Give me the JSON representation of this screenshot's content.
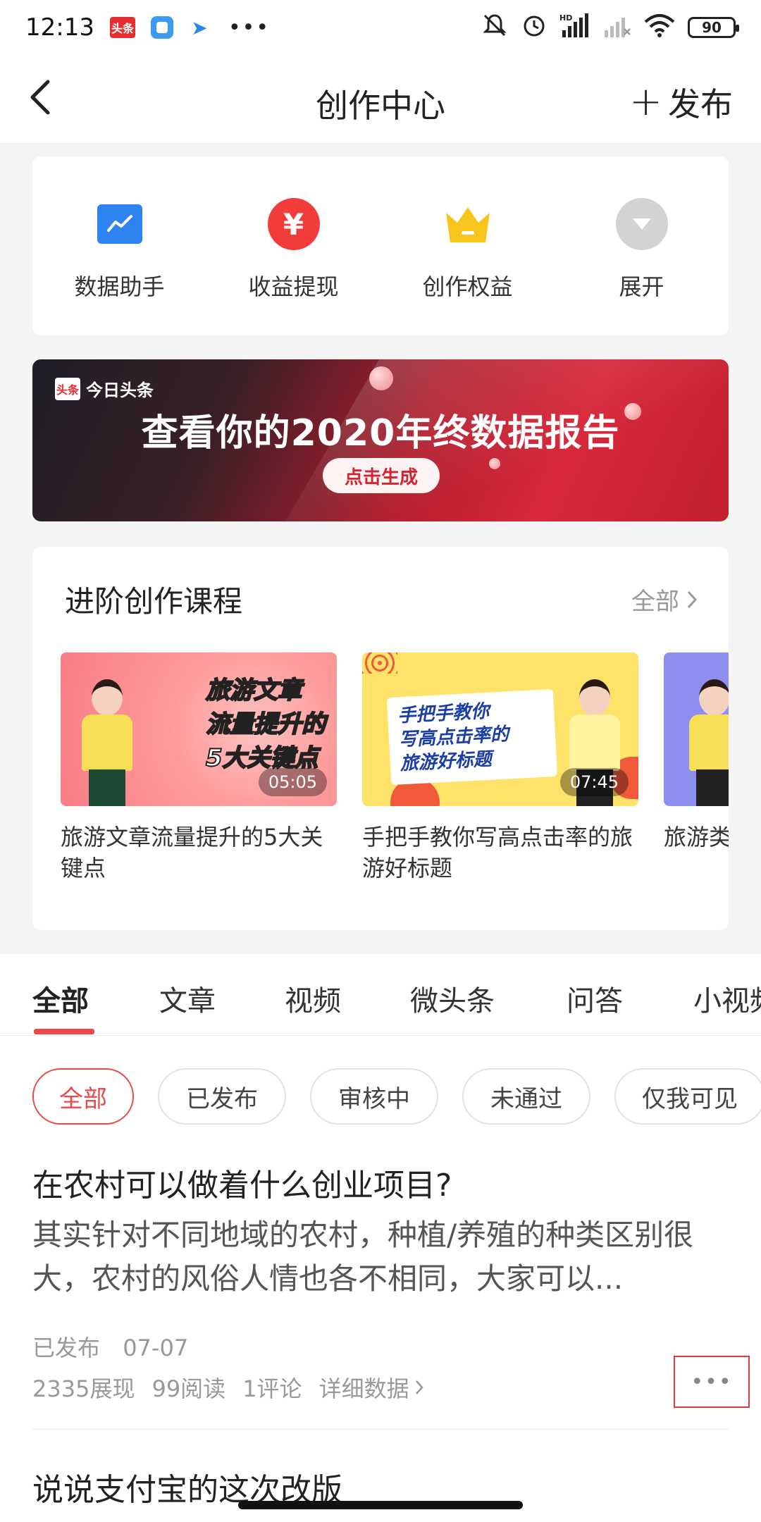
{
  "status_bar": {
    "time": "12:13",
    "toutiao_badge": "头条",
    "battery": "90",
    "network": "HD"
  },
  "nav": {
    "title": "创作中心",
    "publish_label": "发布"
  },
  "tools": [
    {
      "label": "数据助手",
      "icon": "data-chart-icon"
    },
    {
      "label": "收益提现",
      "icon": "yuan-money-icon"
    },
    {
      "label": "创作权益",
      "icon": "crown-icon"
    },
    {
      "label": "展开",
      "icon": "expand-arrow-icon"
    }
  ],
  "banner": {
    "brand": "今日头条",
    "brand_mark": "头条",
    "title": "查看你的2020年终数据报告",
    "button": "点击生成"
  },
  "courses": {
    "heading": "进阶创作课程",
    "view_all": "全部",
    "items": [
      {
        "thumb_lines": [
          "旅游文章",
          "流量提升的",
          "5大关键点"
        ],
        "duration": "05:05",
        "title": "旅游文章流量提升的5大关键点"
      },
      {
        "thumb_lines": [
          "手把手教你",
          "写高点击率的",
          "旅游好标题"
        ],
        "duration": "07:45",
        "title": "手把手教你写高点击率的旅游好标题"
      },
      {
        "thumb_lines": [],
        "duration": "",
        "title": "旅游类"
      }
    ]
  },
  "content_tabs": [
    "全部",
    "文章",
    "视频",
    "微头条",
    "问答",
    "小视频"
  ],
  "active_tab": "全部",
  "filters": [
    "全部",
    "已发布",
    "审核中",
    "未通过",
    "仅我可见"
  ],
  "posts": [
    {
      "title": "在农村可以做着什么创业项目?",
      "excerpt": "其实针对不同地域的农村，种植/养殖的种类区别很大，农村的风俗人情也各不相同，大家可以...",
      "status": "已发布",
      "date": "07-07",
      "impressions": "2335展现",
      "reads": "99阅读",
      "comments": "1评论",
      "details_link": "详细数据"
    },
    {
      "title": "说说支付宝的这次改版"
    }
  ],
  "colors": {
    "accent_red": "#e84a4a",
    "data_blue": "#2d83f0",
    "crown_yellow": "#f7c51c"
  }
}
